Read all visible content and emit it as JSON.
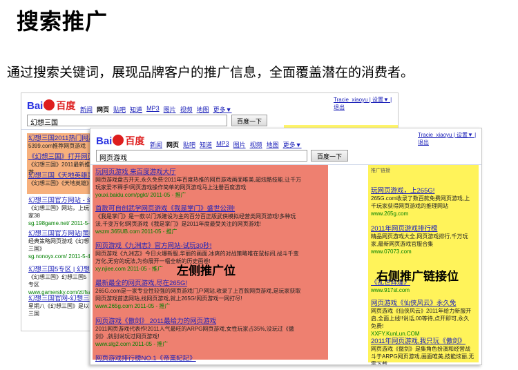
{
  "slide": {
    "title": "搜索推广",
    "subtitle": "通过搜索关键词，展现品牌客户的推广信息，全面覆盖潜在的消费者。"
  },
  "back_screenshot": {
    "logo": {
      "latin": "Bai",
      "cn": "百度"
    },
    "nav": [
      "新闻",
      "网页",
      "贴吧",
      "知道",
      "MP3",
      "图片",
      "视频",
      "地图",
      "更多▼"
    ],
    "user": "Tracie_xiaoyu | 设置▼ | 退出",
    "query": "幻想三国",
    "search_button": "百度一下",
    "left_items": [
      {
        "title": "幻想三国2011热门网游",
        "desc": "5399.com推荐网页游戏",
        "url": ""
      },
      {
        "title": "《幻想三国》打开网页",
        "desc": "《幻想三国》2011最新推荐",
        "url": ""
      },
      {
        "title": "幻想三国《天地英雄》",
        "desc": "《幻想三国》《天地英雄》",
        "url": ""
      }
    ],
    "organic": [
      {
        "title": "幻想三国官方网站 - 幻想",
        "desc": "《幻想三国》网站，上玩家38",
        "url": "sg.198game.net/ 2011-5-2"
      },
      {
        "title": "幻想三国官方网站|策略",
        "desc": "经典策略网页游戏《幻想三国》",
        "url": "sg.nonoyx.com/ 2011-5-4"
      },
      {
        "title": "幻想三国5专区 | 幻想",
        "desc": "《幻想三国》幻想三国5专区",
        "url": "www.gamersky.com/zt/fsang"
      },
      {
        "title": "幻想三国官网-幻想三",
        "desc": "星期八《幻想三国》是以三国",
        "url": ""
      }
    ]
  },
  "front_screenshot": {
    "logo": {
      "latin": "Bai",
      "cn": "百度"
    },
    "nav": [
      "新闻",
      "网页",
      "贴吧",
      "知道",
      "MP3",
      "图片",
      "视频",
      "地图",
      "更多▼"
    ],
    "user": "Tracie_xiaoyu | 设置▼ | 退出",
    "query": "网页游戏",
    "search_button": "百度一下",
    "left_ads": [
      {
        "title": "玩网页游戏 来百度游戏大厅",
        "desc": "网页游戏盘古开天,永久免费!2011年百度热推的网页游戏画面唯美,超炫酷技能,让千万玩家爱不释手!网页游戏操作简单的网页游戏马上注册百度游戏",
        "url": "youxi.baidu.com/pgkt/ 2011-05 - 推广"
      },
      {
        "title": "首款可自创武学网页游戏《我是掌门》盛世公测!",
        "desc": "《我是掌门》是一款以门派建设为主的百分百正版武侠模拟经营类网页游戏!多种玩法,千变万化!网页游戏《我是掌门》是2011年度最受关注的网页游戏!",
        "url": "wszm.365UB.com 2011-05 - 推广"
      },
      {
        "title": "网页游戏《九洲志》官方网站-试玩30秒!",
        "desc": "网页游戏《九洲志》今日火爆新服,华丽的画面,冰爽的对战策略唯在鼠标间,战斗千变万化,无穷的玩法,为你展开一幅全新的历史画卷!",
        "url": "xy.njiee.com 2011-05 - 推广"
      },
      {
        "title": "最新最全的网页游戏,尽在265G!",
        "desc": "265G.com是一家专业性较强的网页游戏门户网站,收录了上百款网页游戏,是玩家获取网页游戏首选网站,找网页游戏,就上265G!网页游戏一网打尽!",
        "url": "www.265g.com 2011-05 - 推广"
      },
      {
        "title": "网页游戏《傲剑》 2011最给力的网页游戏",
        "desc": "2011网页游戏代表作!2011人气最旺的ARPG网页游戏,女性玩家占35%,没玩过《傲剑》,就别说玩过网页游戏!",
        "url": "www.slg2.com 2011-05 - 推广"
      }
    ],
    "bottom_result": "网页游戏排行榜NO.1《帝業紀記》",
    "right_header": "推广链接",
    "right_ads": [
      {
        "title": "玩网页游戏，上265G!",
        "desc": "265G.com收录了数百款免费网页游戏,上千玩家获得网页游戏的推理网站",
        "url": "www.265g.com"
      },
      {
        "title": "2011年网页游戏排行榜",
        "desc": "精品网页游戏大全,网页游戏排行,千万玩家,最新网页游戏官服合集",
        "url": "www.07073.com"
      },
      {
        "title": "《乱世辉煌》",
        "desc": "",
        "url": "www.917st.com"
      },
      {
        "title": "网页游戏《仙侠风云》永久免",
        "desc": "网页游戏《仙侠风云》2011年给力新服开启,全面上线!!说话,00等待,点开即可,永久免费!",
        "url": "XXFY.KunLun.COM"
      },
      {
        "title": "2011年网页游戏,我只玩《傲剑》",
        "desc": "网页游戏《傲剑》是集角色扮演和经营战斗于ARPG网页游戏,画面唯美,技能炫丽,无需下载",
        "url": ""
      }
    ],
    "label_left": "左侧推广位",
    "label_right": "右侧推广链接位"
  },
  "colors": {
    "left_region": "#ee8070",
    "right_region": "#fff35a",
    "link": "#1d22b9",
    "url": "#008000"
  }
}
